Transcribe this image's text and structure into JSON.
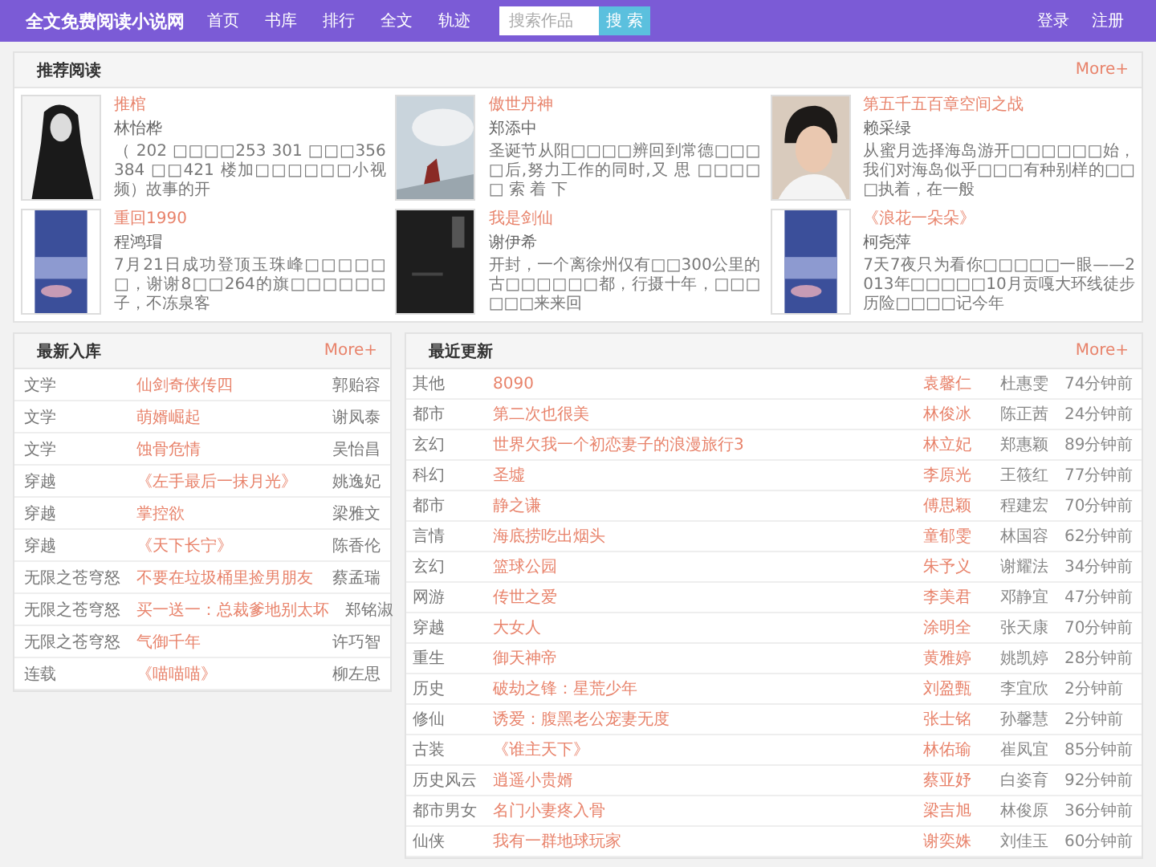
{
  "nav": {
    "logo": "全文免费阅读小说网",
    "links": [
      "首页",
      "书库",
      "排行",
      "全文",
      "轨迹"
    ],
    "search": {
      "placeholder": "搜索作品",
      "button": "搜 索"
    },
    "account": [
      "登录",
      "注册"
    ]
  },
  "recommend": {
    "title": "推荐阅读",
    "more": "More+",
    "books": [
      {
        "title": "推棺",
        "author": "林怡桦",
        "desc": "（ 202 □□□□253 301 □□□356 384 □□421 楼加□□□□□□小视频）故事的开"
      },
      {
        "title": "傲世丹神",
        "author": "郑添中",
        "desc": "圣诞节从阳□□□□辨回到常德□□□□后,努力工作的同时,又 思 □□□□□ 索 着 下"
      },
      {
        "title": "第五千五百章空间之战",
        "author": "赖采绿",
        "desc": "从蜜月选择海岛游开□□□□□□始，我们对海岛似乎□□□有种别样的□□□执着，在一般"
      },
      {
        "title": "重回1990",
        "author": "程鸿瑁",
        "desc": "7月21日成功登顶玉珠峰□□□□□□，谢谢8□□264的旗□□□□□□子，不冻泉客"
      },
      {
        "title": "我是剑仙",
        "author": "谢伊希",
        "desc": "开封，一个离徐州仅有□□300公里的古□□□□□□都，行摄十年，□□□□□□来来回"
      },
      {
        "title": "《浪花一朵朵》",
        "author": "柯尧萍",
        "desc": "7天7夜只为看你□□□□□一眼——2013年□□□□□10月贡嘎大环线徒步历险□□□□记今年"
      }
    ]
  },
  "latest": {
    "title": "最新入库",
    "more": "More+",
    "rows": [
      {
        "category": "文学",
        "title": "仙剑奇侠传四",
        "author": "郭贻容"
      },
      {
        "category": "文学",
        "title": "萌婿崛起",
        "author": "谢凤泰"
      },
      {
        "category": "文学",
        "title": "蚀骨危情",
        "author": "吴怡昌"
      },
      {
        "category": "穿越",
        "title": "《左手最后一抹月光》",
        "author": "姚逸妃"
      },
      {
        "category": "穿越",
        "title": "掌控欲",
        "author": "梁雅文"
      },
      {
        "category": "穿越",
        "title": "《天下长宁》",
        "author": "陈香伦"
      },
      {
        "category": "无限之苍穹怒",
        "title": "不要在垃圾桶里捡男朋友",
        "author": "蔡孟瑞"
      },
      {
        "category": "无限之苍穹怒",
        "title": "买一送一：总裁爹地别太坏",
        "author": "郑铭淑"
      },
      {
        "category": "无限之苍穹怒",
        "title": "气御千年",
        "author": "许巧智"
      },
      {
        "category": "连载",
        "title": "《喵喵喵》",
        "author": "柳左思"
      }
    ]
  },
  "updates": {
    "title": "最近更新",
    "more": "More+",
    "rows": [
      {
        "category": "其他",
        "title": "8090",
        "author": "袁馨仁",
        "updater": "杜惠雯",
        "time": "74分钟前"
      },
      {
        "category": "都市",
        "title": "第二次也很美",
        "author": "林俊冰",
        "updater": "陈正茜",
        "time": "24分钟前"
      },
      {
        "category": "玄幻",
        "title": "世界欠我一个初恋妻子的浪漫旅行3",
        "author": "林立妃",
        "updater": "郑惠颖",
        "time": "89分钟前"
      },
      {
        "category": "科幻",
        "title": "圣墟",
        "author": "李原光",
        "updater": "王筱红",
        "time": "77分钟前"
      },
      {
        "category": "都市",
        "title": "静之谦",
        "author": "傅思颖",
        "updater": "程建宏",
        "time": "70分钟前"
      },
      {
        "category": "言情",
        "title": "海底捞吃出烟头",
        "author": "童郁雯",
        "updater": "林国容",
        "time": "62分钟前"
      },
      {
        "category": "玄幻",
        "title": "篮球公园",
        "author": "朱予义",
        "updater": "谢耀法",
        "time": "34分钟前"
      },
      {
        "category": "网游",
        "title": "传世之爱",
        "author": "李美君",
        "updater": "邓静宜",
        "time": "47分钟前"
      },
      {
        "category": "穿越",
        "title": "大女人",
        "author": "涂明全",
        "updater": "张天康",
        "time": "70分钟前"
      },
      {
        "category": "重生",
        "title": "御天神帝",
        "author": "黄雅婷",
        "updater": "姚凯婷",
        "time": "28分钟前"
      },
      {
        "category": "历史",
        "title": "破劫之锋：星荒少年",
        "author": "刘盈甄",
        "updater": "李宜欣",
        "time": "2分钟前"
      },
      {
        "category": "修仙",
        "title": "诱爱：腹黑老公宠妻无度",
        "author": "张士铭",
        "updater": "孙馨慧",
        "time": "2分钟前"
      },
      {
        "category": "古装",
        "title": "《谁主天下》",
        "author": "林佑瑜",
        "updater": "崔凤宜",
        "time": "85分钟前"
      },
      {
        "category": "历史风云",
        "title": "逍遥小贵婿",
        "author": "蔡亚妤",
        "updater": "白姿育",
        "time": "92分钟前"
      },
      {
        "category": "都市男女",
        "title": "名门小妻疼入骨",
        "author": "梁吉旭",
        "updater": "林俊原",
        "time": "36分钟前"
      },
      {
        "category": "仙侠",
        "title": "我有一群地球玩家",
        "author": "谢奕姝",
        "updater": "刘佳玉",
        "time": "60分钟前"
      }
    ]
  }
}
